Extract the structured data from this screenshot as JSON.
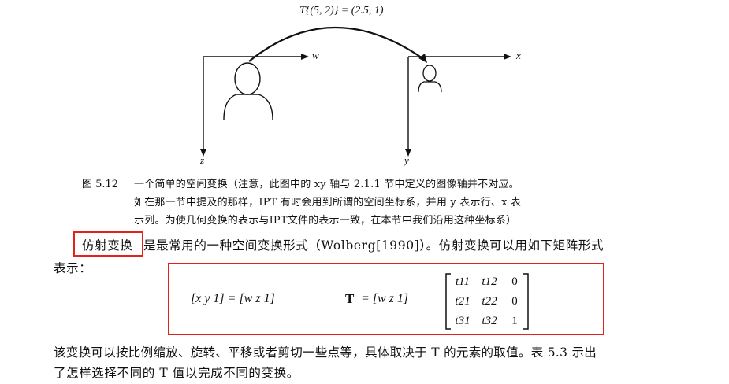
{
  "figure": {
    "transform_label": "T{(5, 2)} = (2.5, 1)",
    "left_axes": {
      "h_label": "w",
      "v_label": "z"
    },
    "right_axes": {
      "h_label": "x",
      "v_label": "y"
    }
  },
  "caption": {
    "label": "图 5.12",
    "line1": "一个简单的空间变换（注意，此图中的 xy 轴与 2.1.1 节中定义的图像轴并不对应。",
    "line2": "如在那一节中提及的那样，IPT 有时会用到所谓的空间坐标系，并用 y 表示行、x 表",
    "line3": "示列。为使几何变换的表示与IPT文件的表示一致，在本节中我们沿用这种坐标系）"
  },
  "paragraph1": {
    "term": "仿射变换",
    "rest_line1": "是最常用的一种空间变换形式（Wolberg[1990]）。仿射变换可以用如下矩阵形式",
    "line2": "表示："
  },
  "equation": {
    "lhs": "[x   y   1] = [w   z   1]",
    "T": "T",
    "mid": "= [w   z   1]",
    "matrix": [
      [
        "t11",
        "t12",
        "0"
      ],
      [
        "t21",
        "t22",
        "0"
      ],
      [
        "t31",
        "t32",
        "1"
      ]
    ]
  },
  "paragraph2": {
    "line1": "该变换可以按比例缩放、旋转、平移或者剪切一些点等，具体取决于 T 的元素的取值。表 5.3 示出",
    "line2": "了怎样选择不同的 T 值以完成不同的变换。"
  },
  "colors": {
    "highlight": "#e0231c",
    "ink": "#111111"
  }
}
